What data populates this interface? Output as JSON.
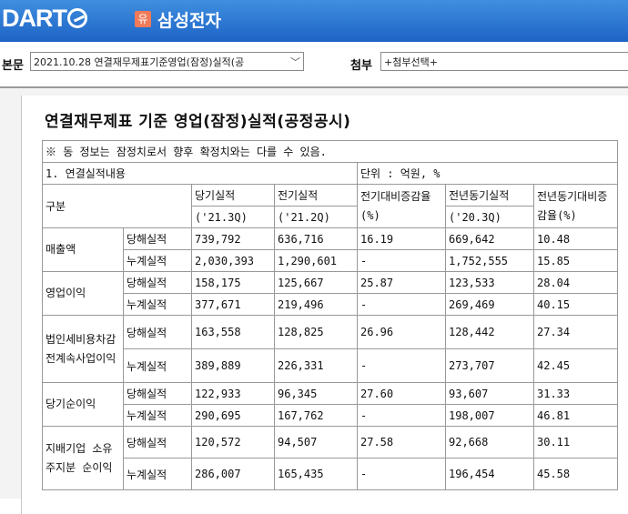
{
  "header": {
    "logo_text": "DART",
    "company_badge": "유",
    "company_name": "삼성전자"
  },
  "filters": {
    "main_label": "본문",
    "main_value": "2021.10.28  연결재무제표기준영업(잠정)실적(공",
    "attach_label": "첨부",
    "attach_value": "+첨부선택+"
  },
  "doc": {
    "title": "연결재무제표 기준 영업(잠정)실적(공정공시)",
    "notice": "※ 동 정보는 잠정치로서 향후 확정치와는 다를 수 있음.",
    "section": "1. 연결실적내용",
    "unit": "단위 : 억원, %",
    "headers": {
      "category": "구분",
      "current": "당기실적",
      "current_period": "('21.3Q)",
      "previous": "전기실적",
      "previous_period": "('21.2Q)",
      "qoq": "전기대비증감율(%)",
      "yoy_prev": "전년동기실적",
      "yoy_prev_period": "('20.3Q)",
      "yoy": "전년동기대비증감율(%)"
    },
    "rows": [
      {
        "item": "매출액",
        "sub": [
          {
            "type": "당해실적",
            "cur": "739,792",
            "prev": "636,716",
            "qoq": "16.19",
            "yprev": "669,642",
            "yoy": "10.48"
          },
          {
            "type": "누계실적",
            "cur": "2,030,393",
            "prev": "1,290,601",
            "qoq": "-",
            "yprev": "1,752,555",
            "yoy": "15.85"
          }
        ]
      },
      {
        "item": "영업이익",
        "sub": [
          {
            "type": "당해실적",
            "cur": "158,175",
            "prev": "125,667",
            "qoq": "25.87",
            "yprev": "123,533",
            "yoy": "28.04"
          },
          {
            "type": "누계실적",
            "cur": "377,671",
            "prev": "219,496",
            "qoq": "-",
            "yprev": "269,469",
            "yoy": "40.15"
          }
        ]
      },
      {
        "item": "법인세비용차감전계속사업이익",
        "sub": [
          {
            "type": "당해실적",
            "cur": "163,558",
            "prev": "128,825",
            "qoq": "26.96",
            "yprev": "128,442",
            "yoy": "27.34"
          },
          {
            "type": "누계실적",
            "cur": "389,889",
            "prev": "226,331",
            "qoq": "-",
            "yprev": "273,707",
            "yoy": "42.45"
          }
        ]
      },
      {
        "item": "당기순이익",
        "sub": [
          {
            "type": "당해실적",
            "cur": "122,933",
            "prev": "96,345",
            "qoq": "27.60",
            "yprev": "93,607",
            "yoy": "31.33"
          },
          {
            "type": "누계실적",
            "cur": "290,695",
            "prev": "167,762",
            "qoq": "-",
            "yprev": "198,007",
            "yoy": "46.81"
          }
        ]
      },
      {
        "item": "지배기업 소유주지분 순이익",
        "sub": [
          {
            "type": "당해실적",
            "cur": "120,572",
            "prev": "94,507",
            "qoq": "27.58",
            "yprev": "92,668",
            "yoy": "30.11"
          },
          {
            "type": "누계실적",
            "cur": "286,007",
            "prev": "165,435",
            "qoq": "-",
            "yprev": "196,454",
            "yoy": "45.58"
          }
        ]
      }
    ]
  }
}
